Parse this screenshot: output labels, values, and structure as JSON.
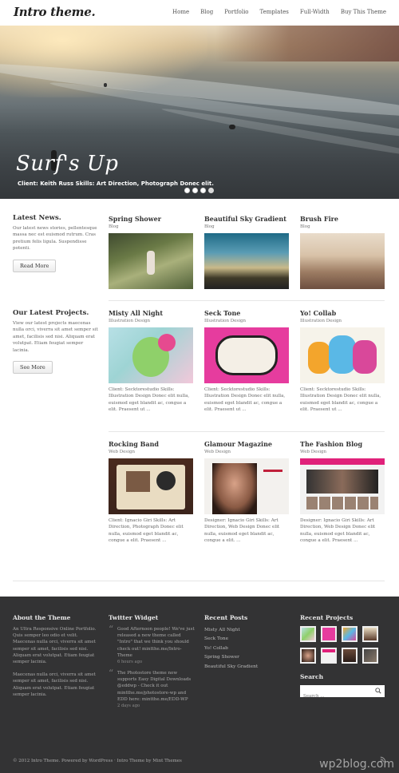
{
  "header": {
    "logo": "Intro theme.",
    "nav": [
      "Home",
      "Blog",
      "Portfolio",
      "Templates",
      "Full-Width",
      "Buy This Theme"
    ]
  },
  "hero": {
    "title": "Surf's Up",
    "caption": "Client: Keith Russ Skills: Art Direction, Photograph Donec elit.",
    "slides": 4,
    "active_slide": 4
  },
  "latest_news": {
    "title": "Latest News.",
    "text": "Our latest news stories, pellentesque massa nec est euismod rutrum. Cras pretium felis ligula. Suspendisse potenti.",
    "button": "Read More",
    "posts": [
      {
        "title": "Spring Shower",
        "category": "Blog"
      },
      {
        "title": "Beautiful Sky Gradient",
        "category": "Blog"
      },
      {
        "title": "Brush Fire",
        "category": "Blog"
      }
    ]
  },
  "latest_projects": {
    "title": "Our Latest Projects.",
    "text": "View our latest projects maecenas nulla orci, viverra sit amet semper sit amet, facilisis sed nisi. Aliquam erat volutpat. Etiam feugiat semper lacinia.",
    "button": "See More",
    "row1": [
      {
        "title": "Misty All Night",
        "category": "Illustration Design",
        "text": "Client: Secktorestudio Skills: Illustration Design Donec elit nulla, euismod eget blandit ac, congue a elit. Praesent ut ..."
      },
      {
        "title": "Seck Tone",
        "category": "Illustration Design",
        "text": "Client: Secktorestudio Skills: Illustration Design Donec elit nulla, euismod eget blandit ac, congue a elit. Praesent ut ..."
      },
      {
        "title": "Yo! Collab",
        "category": "Illustration Design",
        "text": "Client: Secktorestudio Skills: Illustration Design Donec elit nulla, euismod eget blandit ac, congue a elit. Praesent ut ..."
      }
    ],
    "row2": [
      {
        "title": "Rocking Band",
        "category": "Web Design",
        "text": "Client: Ignacio Giri Skills: Art Direction, Photograph Donec elit nulla, euismod eget blandit ac, congue a elit. Praesent ..."
      },
      {
        "title": "Glamour Magazine",
        "category": "Web Design",
        "text": "Designer: Ignacio Giri Skills: Art Direction, Web Design Donec elit nulla, euismod eget blandit ac, congue a elit. ..."
      },
      {
        "title": "The Fashion Blog",
        "category": "Web Design",
        "text": "Designer: Ignacio Giri Skills: Art Direction, Web Design Donec elit nulla, euismod eget blandit ac, congue a elit. Praesent ..."
      }
    ]
  },
  "footer": {
    "about": {
      "title": "About the Theme",
      "p1": "An Ultra Responsive Online Portfolio. Quis semper leo odio et velit. Maecenas nulla orci, viverra sit amet semper sit amet, facilisis sed nisi. Aliquam erat volutpat. Etiam feugiat semper lacinia.",
      "p2": "Maecenas nulla orci, viverra sit amet semper sit amet, facilisis sed nisi. Aliquam erat volutpat. Etiam feugiat semper lacinia."
    },
    "twitter": {
      "title": "Twitter Widget",
      "tweets": [
        {
          "text": "Good Afternoon people! We've just released a new theme called \"Intro\" that we think you should check out! mintthe.me/Intro-Theme",
          "time": "6 hours ago"
        },
        {
          "text": "The Photostore theme now supports Easy Digital Downloads @eddwp - Check it out mintthe.me/photostore-wp and EDD here: mintthe.me/EDD-WP",
          "time": "2 days ago"
        }
      ]
    },
    "recent_posts": {
      "title": "Recent Posts",
      "items": [
        "Misty All Night",
        "Seck Tone",
        "Yo! Collab",
        "Spring Shower",
        "Beautiful Sky Gradient"
      ]
    },
    "recent_projects": {
      "title": "Recent Projects"
    },
    "search": {
      "title": "Search",
      "placeholder": "Search ..."
    },
    "copyright": "© 2012 Intro Theme. Powered by WordPress · Intro Theme by Mint Themes",
    "watermark": "wp2blog.com"
  },
  "colors": {
    "footer_bg": "#333334",
    "accent": "#e63c9e"
  }
}
